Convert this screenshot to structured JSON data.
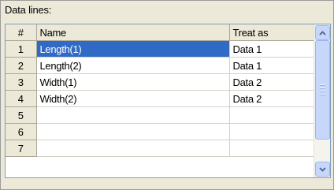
{
  "section": {
    "label": "Data lines:"
  },
  "grid": {
    "headers": {
      "num": "#",
      "name": "Name",
      "treat": "Treat as"
    },
    "rows": [
      {
        "num": "1",
        "name": "Length(1)",
        "treat": "Data 1",
        "selected": true
      },
      {
        "num": "2",
        "name": "Length(2)",
        "treat": "Data 1"
      },
      {
        "num": "3",
        "name": "Width(1)",
        "treat": "Data 2"
      },
      {
        "num": "4",
        "name": "Width(2)",
        "treat": "Data 2"
      },
      {
        "num": "5",
        "name": "",
        "treat": ""
      },
      {
        "num": "6",
        "name": "",
        "treat": ""
      },
      {
        "num": "7",
        "name": "",
        "treat": ""
      }
    ]
  },
  "scrollbar": {
    "up_icon": "chevron-up-icon",
    "down_icon": "chevron-down-icon"
  },
  "colors": {
    "selection": "#316ac5",
    "header": "#ece9d8",
    "scroll": "#c6d7fb"
  }
}
